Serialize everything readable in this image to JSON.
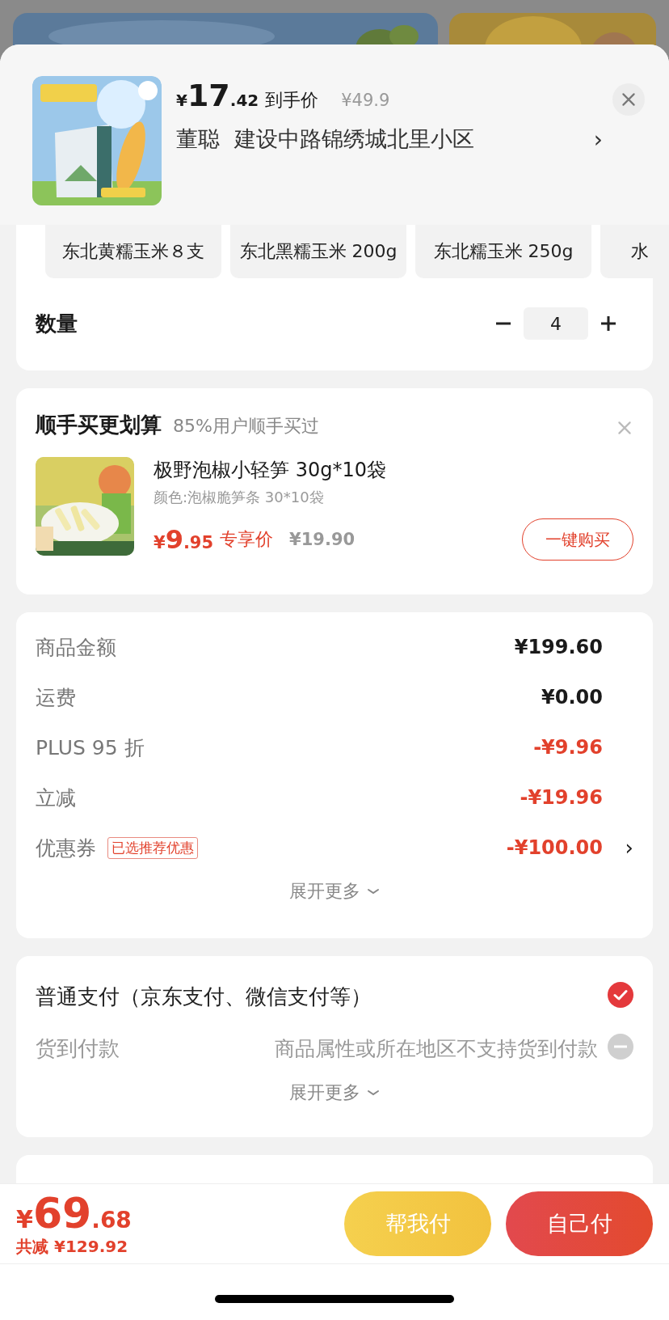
{
  "header": {
    "price_symbol": "¥",
    "price_integer": "17",
    "price_decimal": ".42",
    "price_label": "到手价",
    "original_price": "¥49.9",
    "recipient": "董聪",
    "address": "建设中路锦绣城北里小区",
    "address_arrow": "›"
  },
  "variants": [
    {
      "label": "东北黄糯玉米８支",
      "selected": false
    },
    {
      "label": "东北黑糯玉米 200g",
      "selected": false
    },
    {
      "label": "东北糯玉米 250g",
      "selected": false
    },
    {
      "label": "水",
      "selected": false
    }
  ],
  "quantity": {
    "label": "数量",
    "value": "4"
  },
  "addon": {
    "title": "顺手买更划算",
    "subtitle": "85%用户顺手买过",
    "name": "极野泡椒小轻笋 30g*10袋",
    "spec": "颜色:泡椒脆笋条 30*10袋",
    "price_symbol": "¥",
    "price_integer": "9",
    "price_decimal": ".95",
    "price_label": "专享价",
    "original_price": "¥19.90",
    "button": "一键购买"
  },
  "summary": {
    "rows": [
      {
        "label": "商品金额",
        "value": "¥199.60",
        "kind": "charge"
      },
      {
        "label": "运费",
        "value": "¥0.00",
        "kind": "charge"
      },
      {
        "label": "PLUS 95 折",
        "value": "-¥9.96",
        "kind": "discount"
      },
      {
        "label": "立减",
        "value": "-¥19.96",
        "kind": "discount"
      },
      {
        "label": "优惠券",
        "tag": "已选推荐优惠",
        "value": "-¥100.00",
        "kind": "discount",
        "arrow": "›"
      }
    ],
    "expand": "展开更多"
  },
  "payment": {
    "options": [
      {
        "label": "普通支付（京东支付、微信支付等）",
        "checked": true,
        "disabled": false
      },
      {
        "label": "货到付款",
        "note": "商品属性或所在地区不支持货到付款",
        "checked": false,
        "disabled": true
      }
    ],
    "expand": "展开更多"
  },
  "footer": {
    "price_symbol": "¥",
    "price_integer": "69",
    "price_decimal": ".68",
    "savings": "共减 ¥129.92",
    "buttons": [
      {
        "label": "帮我付",
        "kind": "secondary"
      },
      {
        "label": "自己付",
        "kind": "primary"
      }
    ]
  }
}
